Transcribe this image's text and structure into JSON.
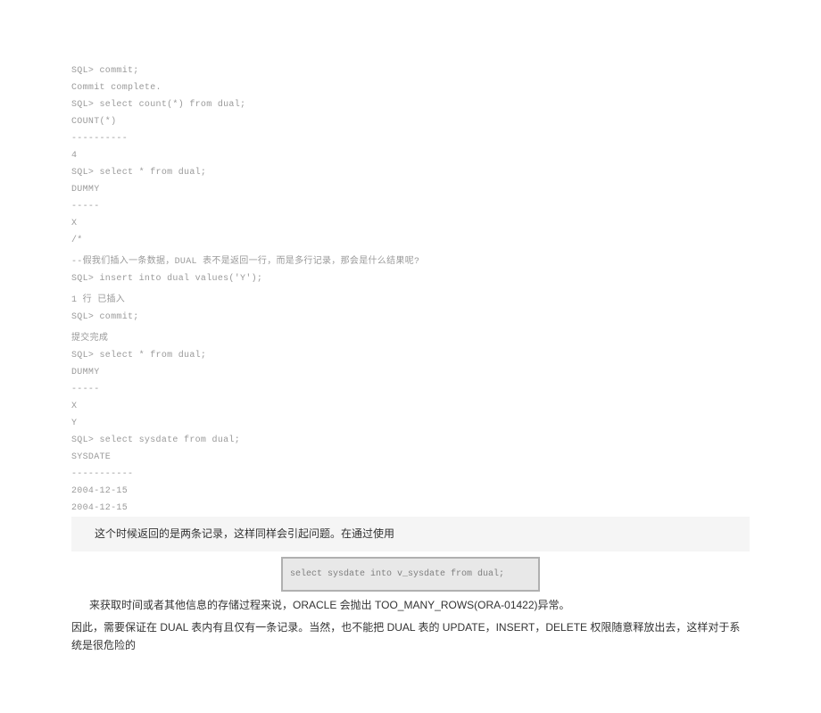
{
  "lines": {
    "l1": "SQL> commit;",
    "l2": "Commit complete.",
    "l3": "SQL> select count(*) from dual;",
    "l4": "COUNT(*)",
    "l5": "----------",
    "l6": "4",
    "l7": "SQL> select * from dual;",
    "l8": "DUMMY",
    "l9": "-----",
    "l10": "X",
    "l11": "/*",
    "l12": "--假我们插入一条数据，DUAL 表不是返回一行，而是多行记录，那会是什么结果呢?",
    "l13": "SQL> insert into dual values('Y');",
    "l14": "1 行 已插入",
    "l15": "SQL> commit;",
    "l16": "提交完成",
    "l17": "SQL> select * from dual;",
    "l18": "DUMMY",
    "l19": "-----",
    "l20": "X",
    "l21": "Y",
    "l22": "SQL> select sysdate from dual;",
    "l23": "SYSDATE",
    "l24": "-----------",
    "l25": "2004-12-15",
    "l26": "2004-12-15"
  },
  "note1": "这个时候返回的是两条记录，这样同样会引起问题。在通过使用",
  "codebox": "select sysdate into v_sysdate from dual;",
  "note2": "来获取时间或者其他信息的存储过程来说，ORACLE 会抛出 TOO_MANY_ROWS(ORA-01422)异常。",
  "note3": "因此，需要保证在 DUAL 表内有且仅有一条记录。当然，也不能把 DUAL 表的 UPDATE，INSERT，DELETE 权限随意释放出去，这样对于系统是很危险的"
}
